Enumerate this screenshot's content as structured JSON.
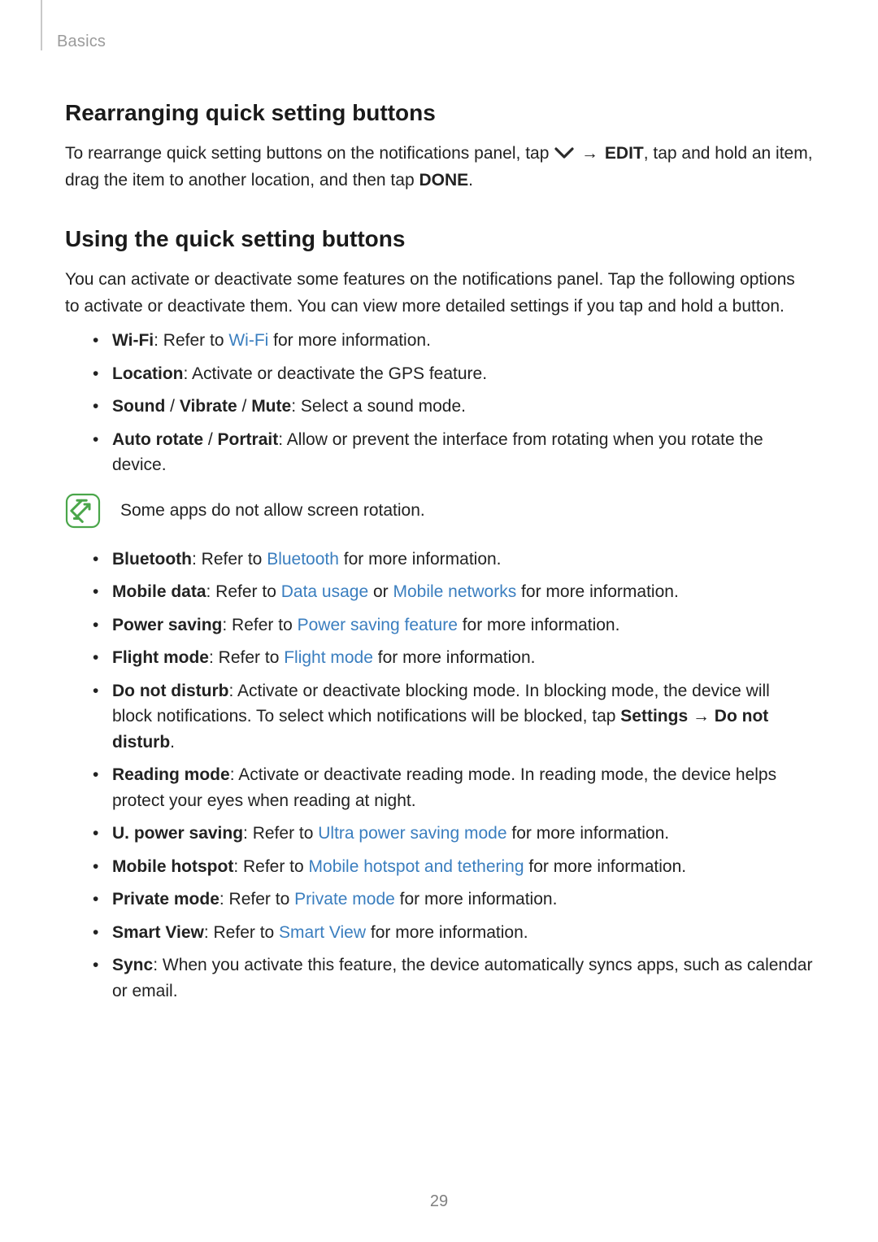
{
  "breadcrumb": "Basics",
  "section1": {
    "title": "Rearranging quick setting buttons",
    "para_pre": "To rearrange quick setting buttons on the notifications panel, tap ",
    "arrow": " → ",
    "edit": "EDIT",
    "para_mid": ", tap and hold an item, drag the item to another location, and then tap ",
    "done": "DONE",
    "para_end": "."
  },
  "section2": {
    "title": "Using the quick setting buttons",
    "intro": "You can activate or deactivate some features on the notifications panel. Tap the following options to activate or deactivate them. You can view more detailed settings if you tap and hold a button."
  },
  "list1": [
    {
      "bold": "Wi-Fi",
      "pre": ": Refer to ",
      "link": "Wi-Fi",
      "post": " for more information."
    },
    {
      "bold": "Location",
      "pre": ": Activate or deactivate the GPS feature."
    },
    {
      "bold": "Sound",
      "sep1": " / ",
      "bold2": "Vibrate",
      "sep2": " / ",
      "bold3": "Mute",
      "pre": ": Select a sound mode."
    },
    {
      "bold": "Auto rotate",
      "sep1": " / ",
      "bold2": "Portrait",
      "pre": ": Allow or prevent the interface from rotating when you rotate the device."
    }
  ],
  "note": "Some apps do not allow screen rotation.",
  "list2": [
    {
      "bold": "Bluetooth",
      "pre": ": Refer to ",
      "link": "Bluetooth",
      "post": " for more information."
    },
    {
      "bold": "Mobile data",
      "pre": ": Refer to ",
      "link": "Data usage",
      "mid": " or ",
      "link2": "Mobile networks",
      "post": " for more information."
    },
    {
      "bold": "Power saving",
      "pre": ": Refer to ",
      "link": "Power saving feature",
      "post": " for more information."
    },
    {
      "bold": "Flight mode",
      "pre": ": Refer to ",
      "link": "Flight mode",
      "post": " for more information."
    },
    {
      "bold": "Do not disturb",
      "pre": ": Activate or deactivate blocking mode. In blocking mode, the device will block notifications. To select which notifications will be blocked, tap ",
      "boldinline": "Settings",
      "arrow": " → ",
      "boldinline2": "Do not disturb",
      "post2": "."
    },
    {
      "bold": "Reading mode",
      "pre": ": Activate or deactivate reading mode. In reading mode, the device helps protect your eyes when reading at night."
    },
    {
      "bold": "U. power saving",
      "pre": ": Refer to ",
      "link": "Ultra power saving mode",
      "post": " for more information."
    },
    {
      "bold": "Mobile hotspot",
      "pre": ": Refer to ",
      "link": "Mobile hotspot and tethering",
      "post": " for more information."
    },
    {
      "bold": "Private mode",
      "pre": ": Refer to ",
      "link": "Private mode",
      "post": " for more information."
    },
    {
      "bold": "Smart View",
      "pre": ": Refer to ",
      "link": "Smart View",
      "post": " for more information."
    },
    {
      "bold": "Sync",
      "pre": ": When you activate this feature, the device automatically syncs apps, such as calendar or email."
    }
  ],
  "page_number": "29"
}
